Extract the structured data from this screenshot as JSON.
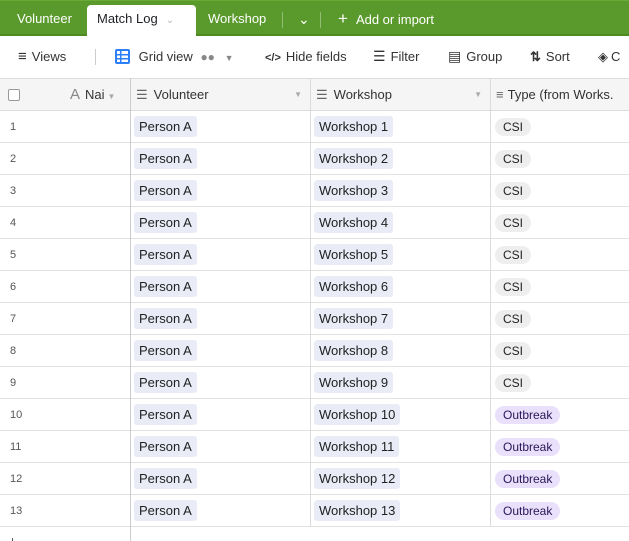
{
  "tabs": [
    {
      "label": "Volunteer",
      "active": false
    },
    {
      "label": "Match Log",
      "active": true
    },
    {
      "label": "Workshop",
      "active": false
    }
  ],
  "tab_overflow_icon": "chevron-down-icon",
  "add_or_import_label": "Add or import",
  "toolbar": {
    "views_label": "Views",
    "grid_view_label": "Grid view",
    "hide_fields_label": "Hide fields",
    "filter_label": "Filter",
    "group_label": "Group",
    "sort_label": "Sort",
    "color_label": "C"
  },
  "columns": [
    {
      "label": "Nai",
      "icon": "text-icon"
    },
    {
      "label": "Volunteer",
      "icon": "link-icon"
    },
    {
      "label": "Workshop",
      "icon": "link-icon"
    },
    {
      "label": "Type (from Works.",
      "icon": "lookup-icon"
    }
  ],
  "colors": {
    "brand_green": "#5a9a2c",
    "csi_tag": "#eeeeee",
    "outbreak_tag": "#e9e0fb",
    "link_pill": "#e9ecf7"
  },
  "rows": [
    {
      "n": "1",
      "volunteer": "Person A",
      "workshop": "Workshop 1",
      "type": "CSI"
    },
    {
      "n": "2",
      "volunteer": "Person A",
      "workshop": "Workshop 2",
      "type": "CSI"
    },
    {
      "n": "3",
      "volunteer": "Person A",
      "workshop": "Workshop 3",
      "type": "CSI"
    },
    {
      "n": "4",
      "volunteer": "Person A",
      "workshop": "Workshop 4",
      "type": "CSI"
    },
    {
      "n": "5",
      "volunteer": "Person A",
      "workshop": "Workshop 5",
      "type": "CSI"
    },
    {
      "n": "6",
      "volunteer": "Person A",
      "workshop": "Workshop 6",
      "type": "CSI"
    },
    {
      "n": "7",
      "volunteer": "Person A",
      "workshop": "Workshop 7",
      "type": "CSI"
    },
    {
      "n": "8",
      "volunteer": "Person A",
      "workshop": "Workshop 8",
      "type": "CSI"
    },
    {
      "n": "9",
      "volunteer": "Person A",
      "workshop": "Workshop 9",
      "type": "CSI"
    },
    {
      "n": "10",
      "volunteer": "Person A",
      "workshop": "Workshop 10",
      "type": "Outbreak"
    },
    {
      "n": "11",
      "volunteer": "Person A",
      "workshop": "Workshop 11",
      "type": "Outbreak"
    },
    {
      "n": "12",
      "volunteer": "Person A",
      "workshop": "Workshop 12",
      "type": "Outbreak"
    },
    {
      "n": "13",
      "volunteer": "Person A",
      "workshop": "Workshop 13",
      "type": "Outbreak"
    }
  ]
}
